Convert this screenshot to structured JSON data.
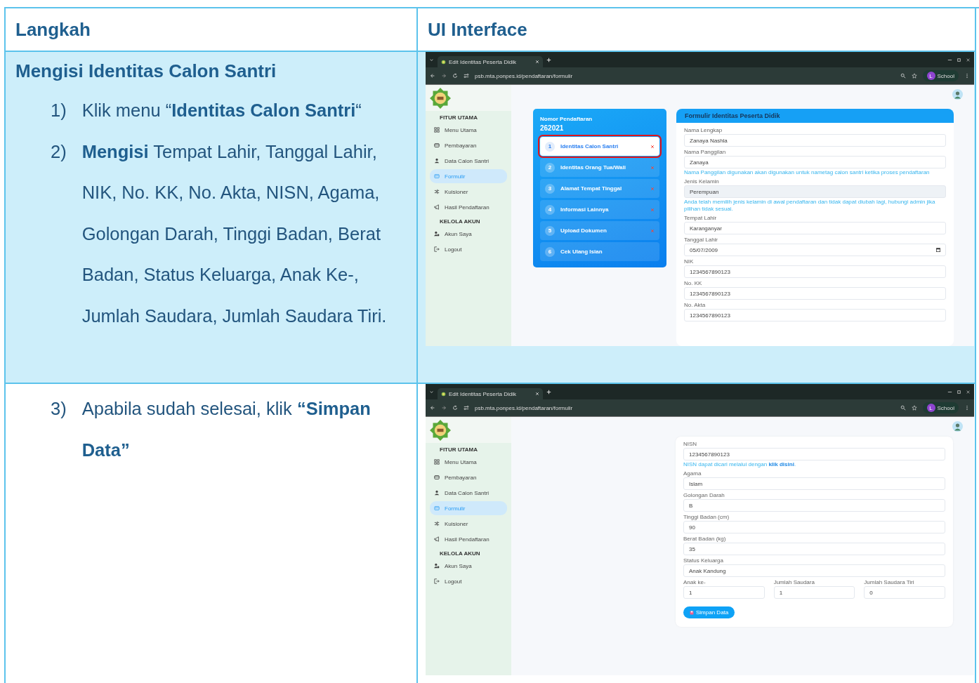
{
  "table": {
    "columns": [
      "Langkah",
      "UI Interface"
    ],
    "rows": [
      {
        "heading": "Mengisi Identitas Calon Santri",
        "steps": [
          {
            "number": "1)",
            "text": "Klik menu “**Identitas Calon Santri**“"
          },
          {
            "number": "2)",
            "text": "**Mengisi** Tempat Lahir, Tanggal Lahir, NIK, No. KK, No. Akta, NISN, Agama, Golongan Darah, Tinggi Badan, Berat Badan, Status Keluarga, Anak Ke-, Jumlah Saudara, Jumlah Saudara Tiri."
          }
        ],
        "screenshot": {
          "tab_title": "Edit Identitas Peserta Didik",
          "url": "psb.mta.ponpes.id/pendaftaran/formulir",
          "profile": {
            "initial": "L",
            "name": "School"
          },
          "sidebar": {
            "sections": [
              {
                "title": "FITUR UTAMA",
                "items": [
                  {
                    "label": "Menu Utama",
                    "selected": false
                  },
                  {
                    "label": "Pembayaran",
                    "selected": false
                  },
                  {
                    "label": "Data Calon Santri",
                    "selected": false
                  },
                  {
                    "label": "Formulir",
                    "selected": true
                  },
                  {
                    "label": "Kuisioner",
                    "selected": false
                  },
                  {
                    "label": "Hasil Pendaftaran",
                    "selected": false
                  }
                ]
              },
              {
                "title": "KELOLA AKUN",
                "items": [
                  {
                    "label": "Akun Saya",
                    "selected": false
                  },
                  {
                    "label": "Logout",
                    "selected": false
                  }
                ]
              }
            ]
          },
          "registration": {
            "label": "Nomor Pendaftaran",
            "number": "262021",
            "steps": [
              {
                "number": "1",
                "label": "Identitas Calon Santri",
                "selected": true,
                "incomplete": true,
                "highlighted": true
              },
              {
                "number": "2",
                "label": "Identitas Orang Tua/Wali",
                "selected": false,
                "incomplete": true,
                "highlighted": false
              },
              {
                "number": "3",
                "label": "Alamat Tempat Tinggal",
                "selected": false,
                "incomplete": true,
                "highlighted": false
              },
              {
                "number": "4",
                "label": "Informasi Lainnya",
                "selected": false,
                "incomplete": true,
                "highlighted": false
              },
              {
                "number": "5",
                "label": "Upload Dokumen",
                "selected": false,
                "incomplete": true,
                "highlighted": false
              },
              {
                "number": "6",
                "label": "Cek Ulang Isian",
                "selected": false,
                "incomplete": false,
                "highlighted": false
              }
            ]
          },
          "form": {
            "title": "Formulir Identitas Peserta Didik",
            "fields": [
              {
                "kind": "text",
                "label": "Nama Lengkap",
                "value": "Zanaya Nashla"
              },
              {
                "kind": "text",
                "label": "Nama Panggilan",
                "value": "Zanaya",
                "hint": "Nama Panggilan digunakan akan digunakan untuk nametag calon santri ketika proses pendaftaran"
              },
              {
                "kind": "readonly",
                "label": "Jenis Kelamin",
                "value": "Perempuan",
                "hint": "Anda telah memilih jenis kelamin di awal pendaftaran dan tidak dapat diubah lagi, hubungi admin jika pilihan tidak sesuai."
              },
              {
                "kind": "text",
                "label": "Tempat Lahir",
                "value": "Karanganyar"
              },
              {
                "kind": "date",
                "label": "Tanggal Lahir",
                "value": "05/07/2009"
              },
              {
                "kind": "text",
                "label": "NIK",
                "value": "1234567890123"
              },
              {
                "kind": "text",
                "label": "No. KK",
                "value": "1234567890123"
              },
              {
                "kind": "text",
                "label": "No. Akta",
                "value": "1234567890123"
              }
            ]
          }
        }
      },
      {
        "steps": [
          {
            "number": "3)",
            "text": "Apabila sudah selesai, klik **“Simpan Data”**"
          }
        ],
        "screenshot": {
          "tab_title": "Edit Identitas Peserta Didik",
          "url": "psb.mta.ponpes.id/pendaftaran/formulir",
          "profile": {
            "initial": "L",
            "name": "School"
          },
          "sidebar": {
            "sections": [
              {
                "title": "FITUR UTAMA",
                "items": [
                  {
                    "label": "Menu Utama",
                    "selected": false
                  },
                  {
                    "label": "Pembayaran",
                    "selected": false
                  },
                  {
                    "label": "Data Calon Santri",
                    "selected": false
                  },
                  {
                    "label": "Formulir",
                    "selected": true
                  },
                  {
                    "label": "Kuisioner",
                    "selected": false
                  },
                  {
                    "label": "Hasil Pendaftaran",
                    "selected": false
                  }
                ]
              },
              {
                "title": "KELOLA AKUN",
                "items": [
                  {
                    "label": "Akun Saya",
                    "selected": false
                  },
                  {
                    "label": "Logout",
                    "selected": false
                  }
                ]
              }
            ]
          },
          "form": {
            "fields": [
              {
                "kind": "text",
                "label": "NISN",
                "value": "1234567890123",
                "hint": "NISN dapat dicari melalui dengan ",
                "hint_link": "klik disini",
                "hint_after": "."
              },
              {
                "kind": "text",
                "label": "Agama",
                "value": "Islam"
              },
              {
                "kind": "text",
                "label": "Golongan Darah",
                "value": "B"
              },
              {
                "kind": "text",
                "label": "Tinggi Badan (cm)",
                "value": "90"
              },
              {
                "kind": "text",
                "label": "Berat Badan (kg)",
                "value": "35"
              },
              {
                "kind": "text",
                "label": "Status Keluarga",
                "value": "Anak Kandung"
              },
              {
                "kind": "columns",
                "fields": [
                  {
                    "kind": "text",
                    "label": "Anak ke-",
                    "value": "1"
                  },
                  {
                    "kind": "text",
                    "label": "Jumlah Saudara",
                    "value": "1"
                  },
                  {
                    "kind": "text",
                    "label": "Jumlah Saudara Tiri",
                    "value": "0"
                  }
                ]
              }
            ],
            "button": "Simpan Data"
          }
        }
      }
    ]
  }
}
